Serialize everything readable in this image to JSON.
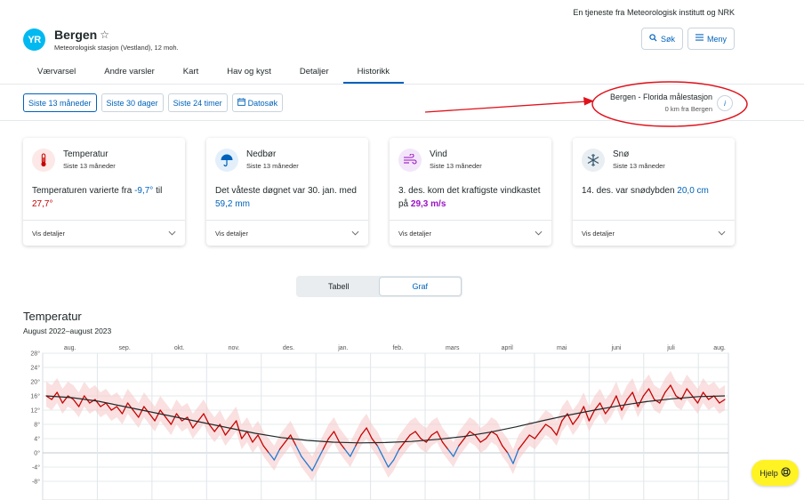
{
  "header": {
    "service_note": "En tjeneste fra Meteorologisk institutt og NRK",
    "logo_text": "YR",
    "location_title": "Bergen",
    "location_subtitle": "Meteorologisk stasjon (Vestland), 12 moh.",
    "search_label": "Søk",
    "menu_label": "Meny"
  },
  "tabs": [
    {
      "label": "Værvarsel",
      "active": false
    },
    {
      "label": "Andre varsler",
      "active": false
    },
    {
      "label": "Kart",
      "active": false
    },
    {
      "label": "Hav og kyst",
      "active": false
    },
    {
      "label": "Detaljer",
      "active": false
    },
    {
      "label": "Historikk",
      "active": true
    }
  ],
  "filters": [
    {
      "label": "Siste 13 måneder",
      "active": true
    },
    {
      "label": "Siste 30 dager",
      "active": false
    },
    {
      "label": "Siste 24 timer",
      "active": false
    },
    {
      "label": "Datosøk",
      "active": false,
      "icon": "calendar-icon"
    }
  ],
  "station": {
    "name": "Bergen - Florida målestasjon",
    "distance": "0 km fra Bergen",
    "info_label": "i"
  },
  "cards": [
    {
      "key": "temperature",
      "icon": "thermometer-icon",
      "icon_bg": "#fde8e8",
      "icon_color": "#c60000",
      "title": "Temperatur",
      "subtitle": "Siste 13 måneder",
      "text_pre": "Temperaturen varierte fra ",
      "value1": "-9,7°",
      "text_mid": " til ",
      "value2": "27,7°",
      "text_post": "",
      "details_label": "Vis detaljer"
    },
    {
      "key": "precipitation",
      "icon": "umbrella-icon",
      "icon_bg": "#e3f0fb",
      "icon_color": "#0062ba",
      "title": "Nedbør",
      "subtitle": "Siste 13 måneder",
      "text_pre": "Det våteste døgnet var 30. jan. med ",
      "value1": "59,2 mm",
      "details_label": "Vis detaljer"
    },
    {
      "key": "wind",
      "icon": "wind-icon",
      "icon_bg": "#f3e6fa",
      "icon_color": "#9b12c4",
      "title": "Vind",
      "subtitle": "Siste 13 måneder",
      "text_pre": "3. des. kom det kraftigste vindkastet på ",
      "value1": "29,3 m/s",
      "details_label": "Vis detaljer"
    },
    {
      "key": "snow",
      "icon": "snowflake-icon",
      "icon_bg": "#e8eef2",
      "icon_color": "#36566b",
      "title": "Snø",
      "subtitle": "Siste 13 måneder",
      "text_pre": "14. des. var snødybden ",
      "value1": "20,0 cm",
      "details_label": "Vis detaljer"
    }
  ],
  "view_toggle": {
    "table_label": "Tabell",
    "graph_label": "Graf",
    "active": "graph"
  },
  "chart": {
    "title": "Temperatur",
    "subtitle": "August 2022–august 2023"
  },
  "chart_data": {
    "type": "line",
    "months": [
      "aug.",
      "sep.",
      "okt.",
      "nov.",
      "des.",
      "jan.",
      "feb.",
      "mars",
      "april",
      "mai",
      "juni",
      "juli",
      "aug."
    ],
    "y_ticks": [
      "28°",
      "24°",
      "20°",
      "16°",
      "12°",
      "8°",
      "4°",
      "0°",
      "-4°",
      "-8°"
    ],
    "ylim": [
      -8,
      30
    ],
    "grid": true,
    "series": [
      {
        "role": "daily-mean",
        "values": [
          16,
          15,
          17,
          14,
          16,
          15,
          13,
          16,
          14,
          15,
          13,
          14,
          12,
          13,
          11,
          14,
          12,
          10,
          13,
          11,
          9,
          12,
          10,
          8,
          11,
          9,
          10,
          7,
          9,
          11,
          8,
          6,
          8,
          5,
          7,
          9,
          4,
          6,
          3,
          5,
          2,
          0,
          -2,
          1,
          3,
          5,
          2,
          -1,
          -3,
          -5,
          -2,
          1,
          4,
          6,
          3,
          1,
          -1,
          2,
          5,
          7,
          4,
          2,
          -1,
          -4,
          -2,
          1,
          3,
          5,
          6,
          4,
          3,
          5,
          6,
          3,
          1,
          -1,
          2,
          4,
          6,
          5,
          3,
          4,
          6,
          5,
          2,
          0,
          -3,
          1,
          3,
          5,
          4,
          6,
          8,
          7,
          5,
          9,
          11,
          8,
          10,
          13,
          9,
          12,
          14,
          11,
          13,
          16,
          12,
          15,
          17,
          13,
          16,
          18,
          15,
          14,
          17,
          19,
          16,
          15,
          18,
          16,
          14,
          17,
          15,
          16,
          14,
          15
        ]
      },
      {
        "role": "normal",
        "values": [
          16,
          15.5,
          14.5,
          13,
          11.5,
          10,
          8.5,
          7,
          5.5,
          4.3,
          3.5,
          3,
          2.8,
          2.9,
          3.2,
          3.8,
          4.6,
          5.8,
          7.3,
          9,
          10.6,
          12,
          13.3,
          14.4,
          15.2,
          15.8,
          16
        ]
      }
    ]
  },
  "help": {
    "label": "Hjelp"
  }
}
